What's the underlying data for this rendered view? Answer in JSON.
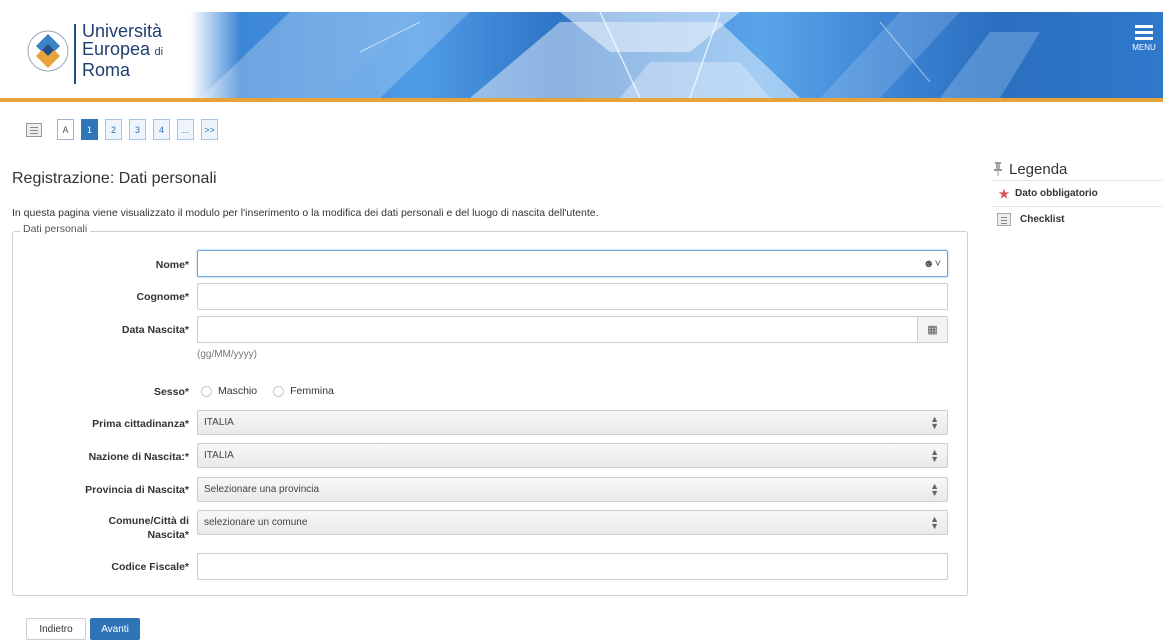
{
  "header": {
    "logo_line1": "Università",
    "logo_line2_big": "Europea",
    "logo_line2_small": "di",
    "logo_line3": "Roma",
    "menu_label": "MENU"
  },
  "pager": {
    "items": [
      "A",
      "1",
      "2",
      "3",
      "4",
      "...",
      ">>"
    ],
    "active_index": 1
  },
  "page": {
    "title": "Registrazione: Dati personali",
    "intro": "In questa pagina viene visualizzato il modulo per l'inserimento o la modifica dei dati personali e del luogo di nascita dell'utente."
  },
  "form": {
    "legend": "Dati personali",
    "nome_label": "Nome*",
    "nome_value": "",
    "cognome_label": "Cognome*",
    "cognome_value": "",
    "data_label": "Data Nascita*",
    "data_value": "",
    "data_hint": "(gg/MM/yyyy)",
    "sesso_label": "Sesso*",
    "sesso_options": [
      "Maschio",
      "Femmina"
    ],
    "cittadinanza_label": "Prima cittadinanza*",
    "cittadinanza_value": "ITALIA",
    "nazione_label": "Nazione di Nascita:*",
    "nazione_value": "ITALIA",
    "provincia_label": "Provincia di Nascita*",
    "provincia_value": "Selezionare una provincia",
    "comune_label_1": "Comune/Città di",
    "comune_label_2": "Nascita*",
    "comune_value": "selezionare un comune",
    "codice_label": "Codice Fiscale*",
    "codice_value": ""
  },
  "legend": {
    "title": "Legenda",
    "items": [
      {
        "icon": "star-icon",
        "label": "Dato obbligatorio"
      },
      {
        "icon": "checklist-icon",
        "label": "Checklist"
      }
    ]
  },
  "buttons": {
    "back": "Indietro",
    "next": "Avanti"
  },
  "colors": {
    "accent_blue": "#2f74b7",
    "header_orange": "#e8a23a",
    "required_red": "#d9534f"
  }
}
